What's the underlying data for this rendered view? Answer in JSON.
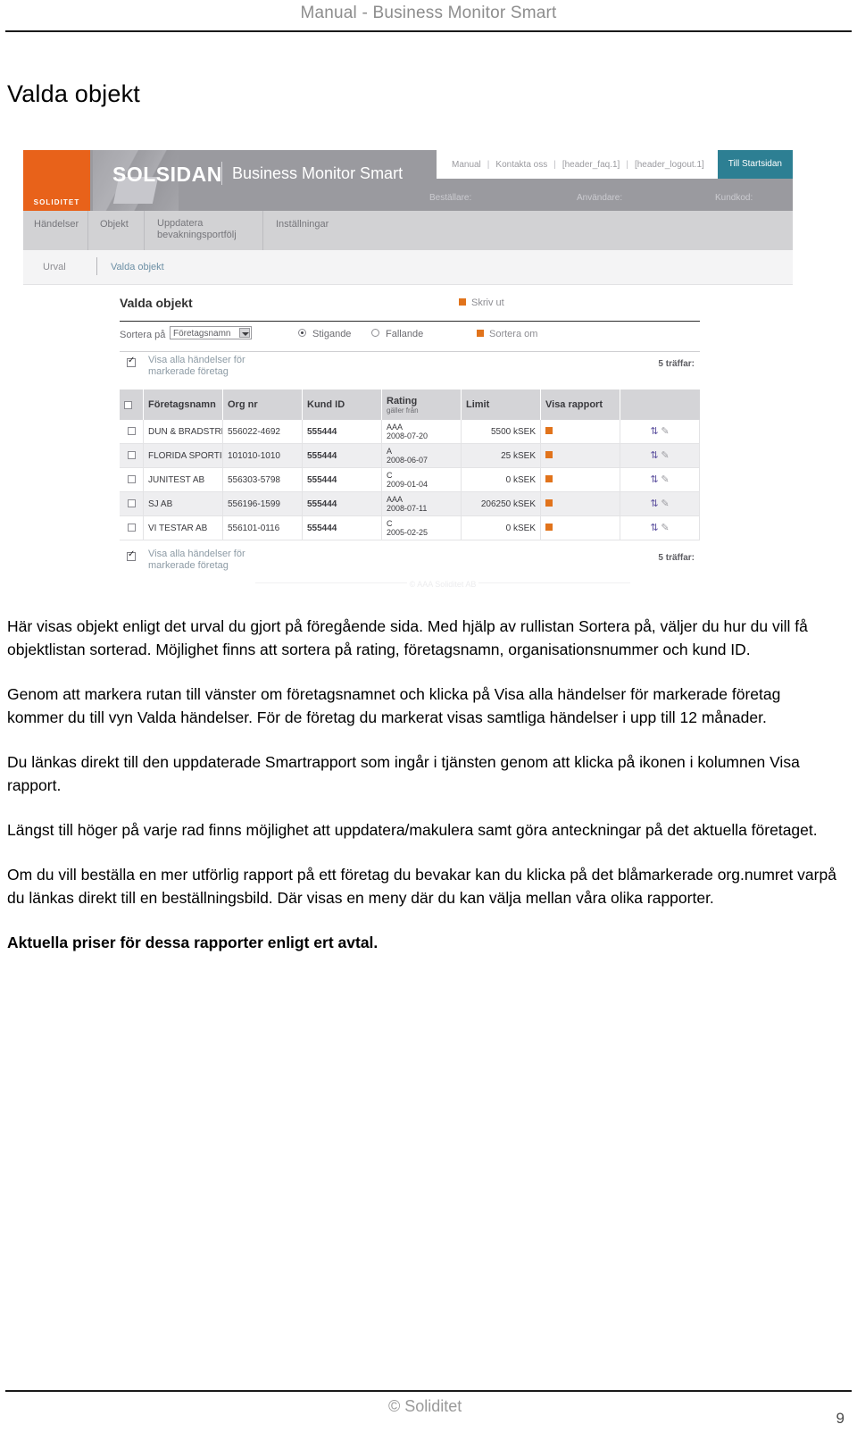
{
  "page": {
    "header_title": "Manual - Business Monitor Smart",
    "section_title": "Valda objekt",
    "footer_copyright": "© Soliditet",
    "page_number": "9"
  },
  "app": {
    "brand": {
      "logo_name": "SOLSIDAN",
      "logo_sub": "SOLIDITET",
      "tagline": "Business Monitor Smart"
    },
    "header_links": {
      "manual": "Manual",
      "contact": "Kontakta oss",
      "faq": "[header_faq.1]",
      "logout": "[header_logout.1]",
      "start_button": "Till Startsidan",
      "sep": "|"
    },
    "meta": {
      "bestallare": "Beställare:",
      "anvandare": "Användare:",
      "kundkod": "Kundkod:"
    },
    "nav": {
      "tabs": [
        {
          "label": "Händelser"
        },
        {
          "label": "Objekt"
        },
        {
          "label_line1": "Uppdatera",
          "label_line2": "bevakningsportfölj"
        },
        {
          "label": "Inställningar"
        }
      ]
    },
    "breadcrumb": {
      "items": [
        {
          "label": "Urval"
        },
        {
          "label": "Valda objekt"
        }
      ]
    },
    "panel": {
      "title": "Valda objekt",
      "print_label": "Skriv ut",
      "sort_label": "Sortera på",
      "sort_selected": "Företagsnamn",
      "radio_asc": "Stigande",
      "radio_desc": "Fallande",
      "resort_label": "Sortera om",
      "show_events_label_line1": "Visa alla händelser för",
      "show_events_label_line2": "markerade företag",
      "hits_top": "5 träffar:",
      "hits_bottom": "5 träffar:",
      "footer_text": "© AAA Soliditet AB"
    },
    "table": {
      "columns": {
        "company": "Företagsnamn",
        "orgnr": "Org nr",
        "kundid": "Kund ID",
        "rating": "Rating",
        "rating_sub": "gäller från",
        "limit": "Limit",
        "report": "Visa rapport"
      },
      "rows": [
        {
          "company": "DUN & BRADSTREET SVERIGE AB",
          "orgnr": "556022-4692",
          "kundid": "555444",
          "rating": "AAA",
          "rating_date": "2008-07-20",
          "limit": "5500 kSEK"
        },
        {
          "company": "FLORIDA SPORTINGCENTERT",
          "orgnr": "101010-1010",
          "kundid": "555444",
          "rating": "A",
          "rating_date": "2008-06-07",
          "limit": "25 kSEK"
        },
        {
          "company": "JUNITEST AB",
          "orgnr": "556303-5798",
          "kundid": "555444",
          "rating": "C",
          "rating_date": "2009-01-04",
          "limit": "0 kSEK"
        },
        {
          "company": "SJ AB",
          "orgnr": "556196-1599",
          "kundid": "555444",
          "rating": "AAA",
          "rating_date": "2008-07-11",
          "limit": "206250 kSEK"
        },
        {
          "company": "VI TESTAR AB",
          "orgnr": "556101-0116",
          "kundid": "555444",
          "rating": "C",
          "rating_date": "2005-02-25",
          "limit": "0 kSEK"
        }
      ]
    },
    "colors": {
      "brand_orange": "#e8621a",
      "banner_gray": "#9a9a9f",
      "start_button": "#2d7f93",
      "link_blue": "#6f9cc0",
      "refresh_icon": "#5b4f9e"
    }
  },
  "body_text": {
    "p1": "Här visas objekt enligt det urval du gjort på föregående sida. Med hjälp av rullistan Sortera på, väljer du hur du vill få objektlistan sorterad. Möjlighet finns att sortera på rating, företagsnamn, organisationsnummer och kund ID.",
    "p2": "Genom att markera rutan till vänster om företagsnamnet och klicka på Visa alla händelser för markerade företag kommer du till vyn Valda händelser. För de företag du markerat visas samtliga händelser i upp till 12 månader.",
    "p3": "Du länkas direkt till den uppdaterade Smartrapport som ingår i tjänsten genom att klicka på ikonen i kolumnen Visa rapport.",
    "p4": "Längst till höger på varje rad finns möjlighet att uppdatera/makulera samt göra anteckningar på det aktuella företaget.",
    "p5": "Om du vill beställa en mer utförlig rapport på ett företag du bevakar kan du klicka på det blåmarkerade org.numret varpå du länkas direkt till en beställningsbild. Där visas en meny där du kan välja mellan våra olika rapporter.",
    "p6": "Aktuella priser för dessa rapporter enligt ert avtal."
  }
}
